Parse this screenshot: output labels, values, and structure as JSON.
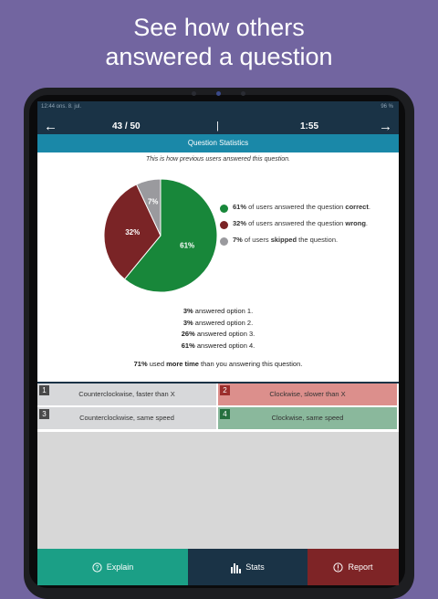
{
  "headline": {
    "line1": "See how others",
    "line2": "answered a question"
  },
  "status": {
    "left": "12:44 ons. 8. jul.",
    "right": "96 %"
  },
  "nav": {
    "back_icon": "arrow-left-icon",
    "count": "43 / 50",
    "separator": "|",
    "timer": "1:55",
    "forward_icon": "arrow-right-icon",
    "progress_fraction": 0.86
  },
  "stats_title": "Question Statistics",
  "intro": "This is how previous users answered this question.",
  "chart_data": {
    "type": "pie",
    "slices": [
      {
        "label": "61%",
        "value": 61,
        "color": "#18873a"
      },
      {
        "label": "32%",
        "value": 32,
        "color": "#7a2426"
      },
      {
        "label": "7%",
        "value": 7,
        "color": "#9a9a9e"
      }
    ]
  },
  "legend": [
    {
      "pct": "61%",
      "pre": " of users answered the question ",
      "bold": "correct",
      "post": ".",
      "color": "#18873a"
    },
    {
      "pct": "32%",
      "pre": " of users answered the question ",
      "bold": "wrong",
      "post": ".",
      "color": "#7a2426"
    },
    {
      "pct": "7%",
      "pre": " of users ",
      "bold": "skipped",
      "post": " the question.",
      "color": "#9a9a9e"
    }
  ],
  "breakdown": [
    {
      "pct": "3%",
      "text": " answered option 1."
    },
    {
      "pct": "3%",
      "text": " answered option 2."
    },
    {
      "pct": "26%",
      "text": " answered option 3."
    },
    {
      "pct": "61%",
      "text": " answered option 4."
    }
  ],
  "time_note": {
    "pct": "71%",
    "pre": " used ",
    "bold": "more time",
    "post": " than you answering this question."
  },
  "options": [
    {
      "num": "1",
      "label": "Counterclockwise, faster than X"
    },
    {
      "num": "2",
      "label": "Clockwise, slower than X"
    },
    {
      "num": "3",
      "label": "Counterclockwise, same speed"
    },
    {
      "num": "4",
      "label": "Clockwise, same speed"
    }
  ],
  "bottom": {
    "explain": "Explain",
    "stats": "Stats",
    "report": "Report"
  }
}
